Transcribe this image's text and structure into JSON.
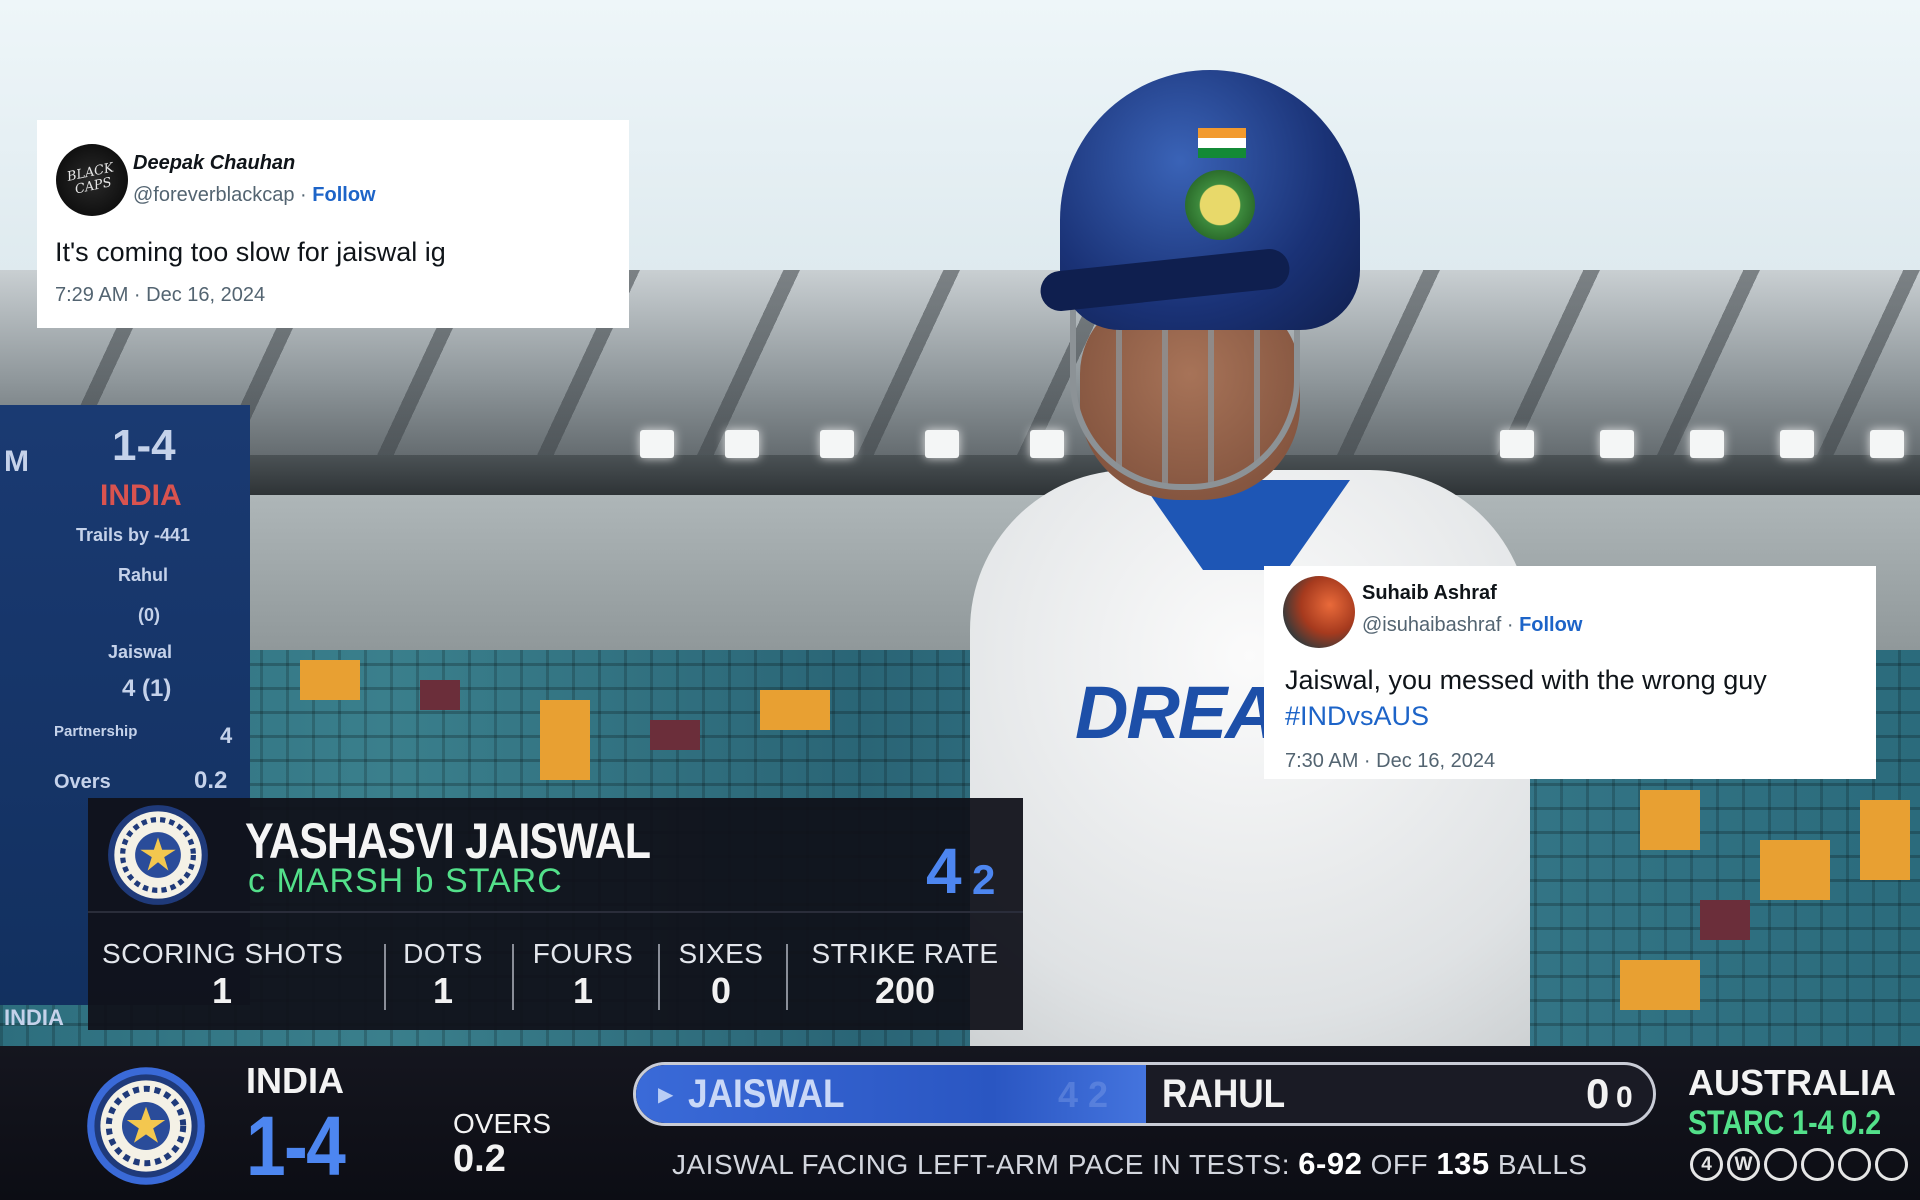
{
  "tweets": [
    {
      "display_name": "Deepak Chauhan",
      "handle": "@foreverblackcap",
      "separator": " · ",
      "follow_label": "Follow",
      "text": "It's coming too slow for jaiswal ig",
      "hashtag": "",
      "timestamp": "7:29 AM · Dec 16, 2024",
      "avatar_text": "BLACK CAPS"
    },
    {
      "display_name": "Suhaib Ashraf",
      "handle": "@isuhaibashraf",
      "separator": " · ",
      "follow_label": "Follow",
      "text": "Jaiswal, you messed with the wrong guy",
      "hashtag": "#INDvsAUS",
      "timestamp": "7:30 AM · Dec 16, 2024"
    }
  ],
  "scoreboard_bg": {
    "score": "1-4",
    "team": "INDIA",
    "trail": "Trails by -441",
    "player1": "Rahul",
    "player1_score": "(0)",
    "player2": "Jaiswal",
    "player2_score": "4 (1)",
    "partnership_label": "Partnership",
    "partnership_value": "4",
    "overs_label": "Overs",
    "overs_value": "0.2",
    "edge_letter": "M",
    "bottom_text": "INDIA"
  },
  "jersey_text": "DREAM",
  "batter_card": {
    "name": "YASHASVI JAISWAL",
    "dismissal": "c MARSH  b STARC",
    "runs": "4",
    "balls": "2",
    "stats": [
      {
        "label": "SCORING SHOTS",
        "value": "1"
      },
      {
        "label": "DOTS",
        "value": "1"
      },
      {
        "label": "FOURS",
        "value": "1"
      },
      {
        "label": "SIXES",
        "value": "0"
      },
      {
        "label": "STRIKE RATE",
        "value": "200"
      }
    ]
  },
  "score_bar": {
    "team": "INDIA",
    "score": "1-4",
    "overs_label": "OVERS",
    "overs": "0.2",
    "striker": "JAISWAL",
    "striker_ghost": "4 2",
    "non_striker": "RAHUL",
    "non_striker_runs": "0",
    "non_striker_balls": "0",
    "stat_prefix": "JAISWAL FACING LEFT-ARM PACE IN TESTS:",
    "stat_value1": "6-92",
    "stat_mid": "OFF",
    "stat_value2": "135",
    "stat_suffix": "BALLS",
    "opponent": "AUSTRALIA",
    "bowler": "STARC 1-4  0.2",
    "this_over": [
      "4",
      "W",
      "",
      "",
      "",
      ""
    ]
  },
  "colors": {
    "india_blue": "#4d86f0",
    "highlight_green": "#53e08a",
    "link_blue": "#1d64c8",
    "bar_dark": "#10111a"
  }
}
